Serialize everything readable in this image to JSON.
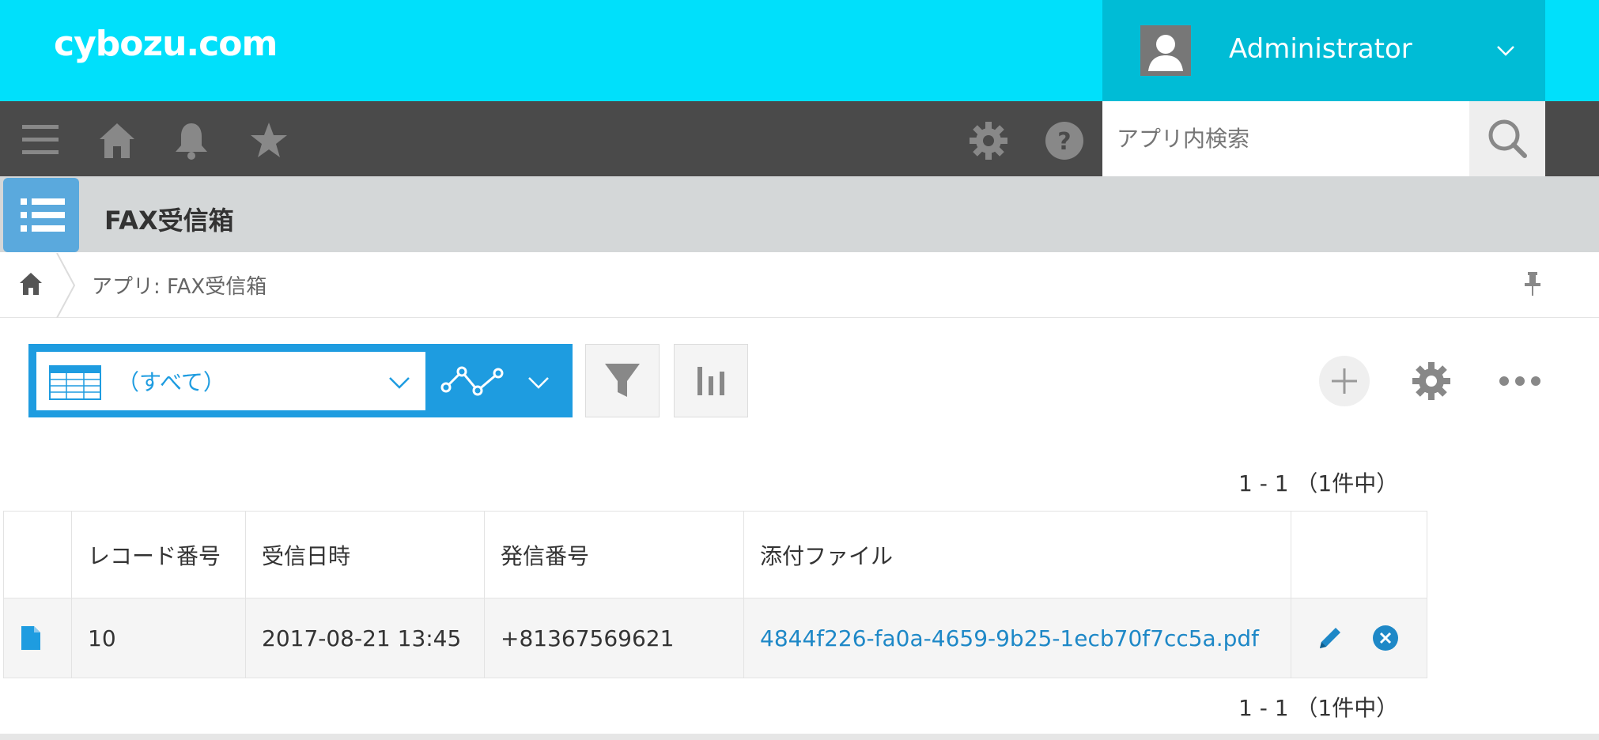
{
  "header": {
    "logo": "cybozu.com",
    "user_name": "Administrator",
    "search_placeholder": "アプリ内検索"
  },
  "app": {
    "title": "FAX受信箱",
    "breadcrumb": "アプリ: FAX受信箱"
  },
  "view": {
    "selected_view": "（すべて）"
  },
  "pagination": {
    "top": "1 - 1 （1件中）",
    "bottom": "1 - 1 （1件中）"
  },
  "table": {
    "columns": [
      "レコード番号",
      "受信日時",
      "発信番号",
      "添付ファイル"
    ],
    "rows": [
      {
        "record_number": "10",
        "received_at": "2017-08-21 13:45",
        "sender_number": "+81367569621",
        "attachment": "4844f226-fa0a-4659-9b25-1ecb70f7cc5a.pdf"
      }
    ]
  },
  "colors": {
    "header_bg": "#00e0fb",
    "user_area_bg": "#00bcd6",
    "nav_bg": "#4a4a4a",
    "accent": "#1e9ce0",
    "link": "#1e88c7"
  }
}
